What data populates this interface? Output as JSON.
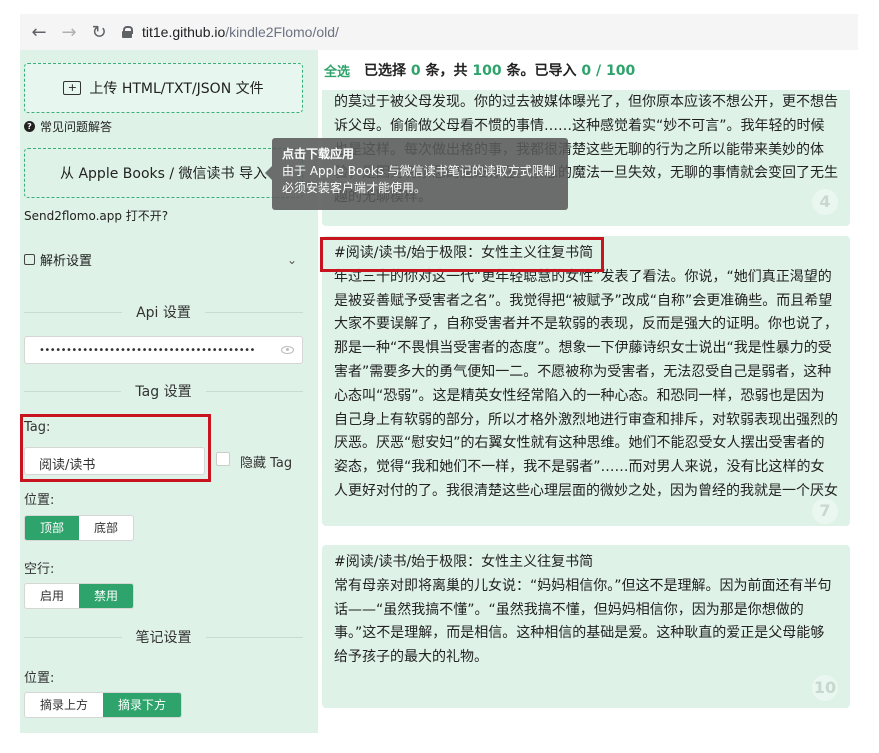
{
  "browser": {
    "url_domain": "tit1e.github.io",
    "url_path": "/kindle2Flomo/old/"
  },
  "sidebar": {
    "upload_label": "上传 HTML/TXT/JSON 文件",
    "faq_label": "常见问题解答",
    "apple_label": "从 Apple Books / 微信读书 导入",
    "send_note": "Send2flomo.app 打不开?",
    "parse_settings": "解析设置",
    "api_title": "Api 设置",
    "api_value": "••••••••••••••••••••••••••••••••••••••••",
    "tag_title": "Tag 设置",
    "tag_label": "Tag:",
    "tag_value": "阅读/读书",
    "hide_tag_label": "隐藏 Tag",
    "position_label": "位置:",
    "position_options": [
      "顶部",
      "底部"
    ],
    "blank_label": "空行:",
    "blank_options": [
      "启用",
      "禁用"
    ],
    "note_title": "笔记设置",
    "note_position_label": "位置:",
    "note_position_options": [
      "摘录上方",
      "摘录下方"
    ]
  },
  "main": {
    "select_all": "全选",
    "selected_prefix": "已选择",
    "selected_count": "0",
    "selected_mid": "条，共",
    "total_count": "100",
    "imported_prefix": "条。已导入",
    "imported_value": "0 / 100",
    "cards": [
      {
        "number": "4",
        "text": "的莫过于被父母发现。你的过去被媒体曝光了，但你原本应该不想公开，更不想告诉父母。偷偷做父母看不惯的事情……这种感觉着实“妙不可言”。我年轻的时候也是这样。每次做出格的事，我都很清楚这些无聊的行为之所以能带来美妙的体验，是因为有禁忌的魔法存在。禁忌的魔法一旦失效，无聊的事情就会变回了无生趣的无聊模样。"
      },
      {
        "number": "7",
        "title": "#阅读/读书/始于极限：女性主义往复书简",
        "text": "年过三十的你对这一代“更年轻聪慧的女性”发表了看法。你说，“她们真正渴望的是被妥善赋予受害者之名”。我觉得把“被赋予”改成“自称”会更准确些。而且希望大家不要误解了，自称受害者并不是软弱的表现，反而是强大的证明。你也说了，那是一种“不畏惧当受害者的态度”。想象一下伊藤诗织女士说出“我是性暴力的受害者”需要多大的勇气便知一二。不愿被称为受害者，无法忍受自己是弱者，这种心态叫“恐弱”。这是精英女性经常陷入的一种心态。和恐同一样，恐弱也是因为自己身上有软弱的部分，所以才格外激烈地进行审查和排斥，对软弱表现出强烈的厌恶。厌恶“慰安妇”的右翼女性就有这种思维。她们不能忍受女人摆出受害者的姿态，觉得“我和她们不一样，我不是弱者”……而对男人来说，没有比这样的女人更好对付的了。我很清楚这些心理层面的微妙之处，因为曾经的我就是一个厌女"
      },
      {
        "number": "10",
        "title": "#阅读/读书/始于极限：女性主义往复书简",
        "text": "常有母亲对即将离巢的儿女说：“妈妈相信你。”但这不是理解。因为前面还有半句话——“虽然我搞不懂”。“虽然我搞不懂，但妈妈相信你，因为那是你想做的事。”这不是理解，而是相信。这种相信的基础是爱。这种耿直的爱正是父母能够给予孩子的最大的礼物。"
      }
    ]
  },
  "tooltip": {
    "title": "点击下载应用",
    "line1": "由于 Apple Books 与微信读书笔记的读取方式限制",
    "line2": "必须安装客户端才能使用。"
  }
}
